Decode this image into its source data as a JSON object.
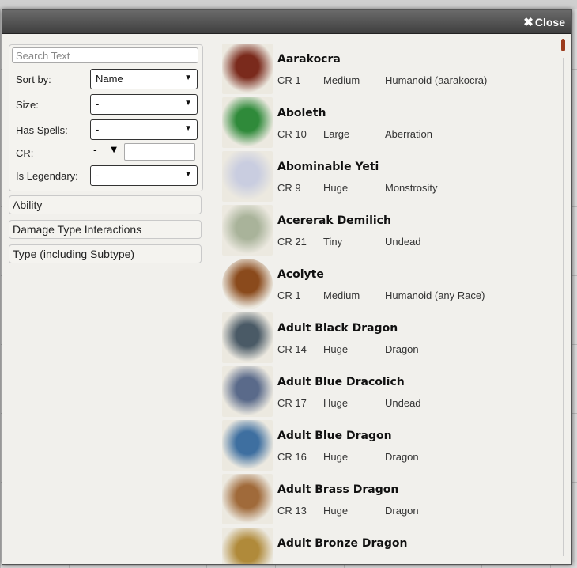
{
  "dialog": {
    "close_label": "Close"
  },
  "filters": {
    "search_placeholder": "Search Text",
    "sort_label": "Sort by:",
    "sort_value": "Name",
    "size_label": "Size:",
    "size_value": "-",
    "spells_label": "Has Spells:",
    "spells_value": "-",
    "cr_label": "CR:",
    "cr_value": "-",
    "legendary_label": "Is Legendary:",
    "legendary_value": "-",
    "sections": [
      "Ability",
      "Damage Type Interactions",
      "Type (including Subtype)"
    ]
  },
  "monsters": [
    {
      "name": "Aarakocra",
      "cr": "CR 1",
      "size": "Medium",
      "type": "Humanoid (aarakocra)",
      "color": "#7a2a1c"
    },
    {
      "name": "Aboleth",
      "cr": "CR 10",
      "size": "Large",
      "type": "Aberration",
      "color": "#2f8a3a"
    },
    {
      "name": "Abominable Yeti",
      "cr": "CR 9",
      "size": "Huge",
      "type": "Monstrosity",
      "color": "#c9cde0"
    },
    {
      "name": "Acererak Demilich",
      "cr": "CR 21",
      "size": "Tiny",
      "type": "Undead",
      "color": "#a9b39a"
    },
    {
      "name": "Acolyte",
      "cr": "CR 1",
      "size": "Medium",
      "type": "Humanoid (any Race)",
      "color": "#8a4a1c"
    },
    {
      "name": "Adult Black Dragon",
      "cr": "CR 14",
      "size": "Huge",
      "type": "Dragon",
      "color": "#4a5a66"
    },
    {
      "name": "Adult Blue Dracolich",
      "cr": "CR 17",
      "size": "Huge",
      "type": "Undead",
      "color": "#5a6a8a"
    },
    {
      "name": "Adult Blue Dragon",
      "cr": "CR 16",
      "size": "Huge",
      "type": "Dragon",
      "color": "#3e6fa0"
    },
    {
      "name": "Adult Brass Dragon",
      "cr": "CR 13",
      "size": "Huge",
      "type": "Dragon",
      "color": "#a06a3a"
    },
    {
      "name": "Adult Bronze Dragon",
      "cr": "",
      "size": "",
      "type": "",
      "color": "#b08a3a"
    }
  ]
}
